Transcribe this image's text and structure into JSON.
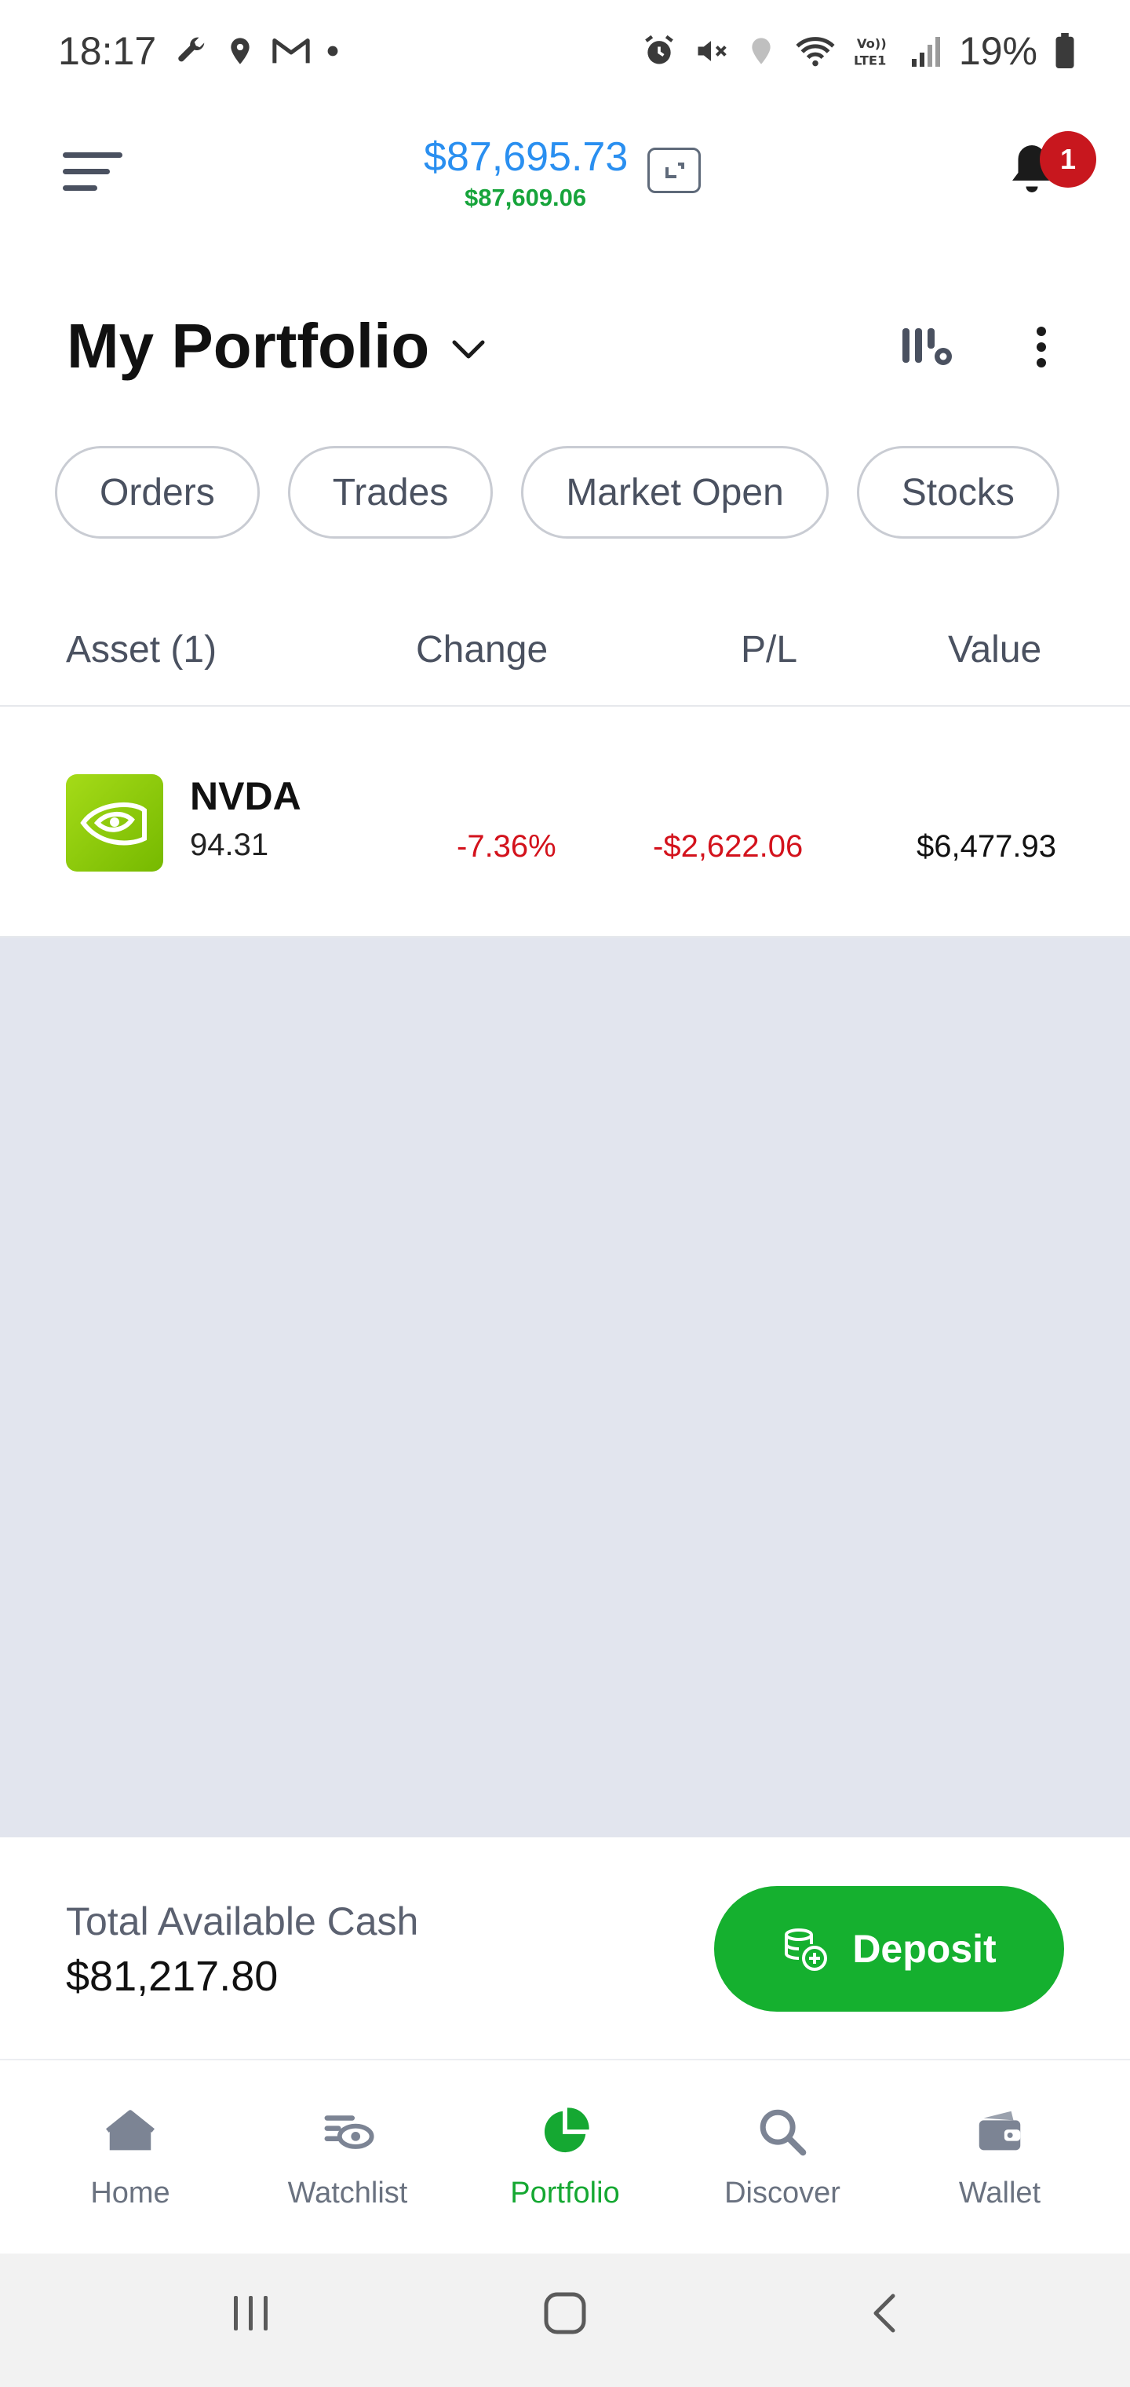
{
  "status_bar": {
    "time": "18:17",
    "battery": "19%"
  },
  "header": {
    "balance_main": "$87,695.73",
    "balance_sub": "$87,609.06",
    "notifications_count": "1"
  },
  "portfolio": {
    "title": "My Portfolio"
  },
  "filters": [
    "Orders",
    "Trades",
    "Market Open",
    "Stocks"
  ],
  "table": {
    "headers": {
      "asset": "Asset (1)",
      "change": "Change",
      "pl": "P/L",
      "value": "Value"
    },
    "rows": [
      {
        "symbol": "NVDA",
        "price": "94.31",
        "change": "-7.36%",
        "pl": "-$2,622.06",
        "value": "$6,477.93"
      }
    ]
  },
  "cash": {
    "label": "Total Available Cash",
    "value": "$81,217.80",
    "deposit_label": "Deposit"
  },
  "bottom_nav": {
    "items": [
      {
        "label": "Home",
        "icon": "home-icon",
        "active": false
      },
      {
        "label": "Watchlist",
        "icon": "watchlist-icon",
        "active": false
      },
      {
        "label": "Portfolio",
        "icon": "portfolio-icon",
        "active": true
      },
      {
        "label": "Discover",
        "icon": "search-icon",
        "active": false
      },
      {
        "label": "Wallet",
        "icon": "wallet-icon",
        "active": false
      }
    ]
  },
  "colors": {
    "accent_green": "#15b02f",
    "balance_blue": "#2a8ff0",
    "negative_red": "#d3121c",
    "badge_red": "#c8171e"
  }
}
